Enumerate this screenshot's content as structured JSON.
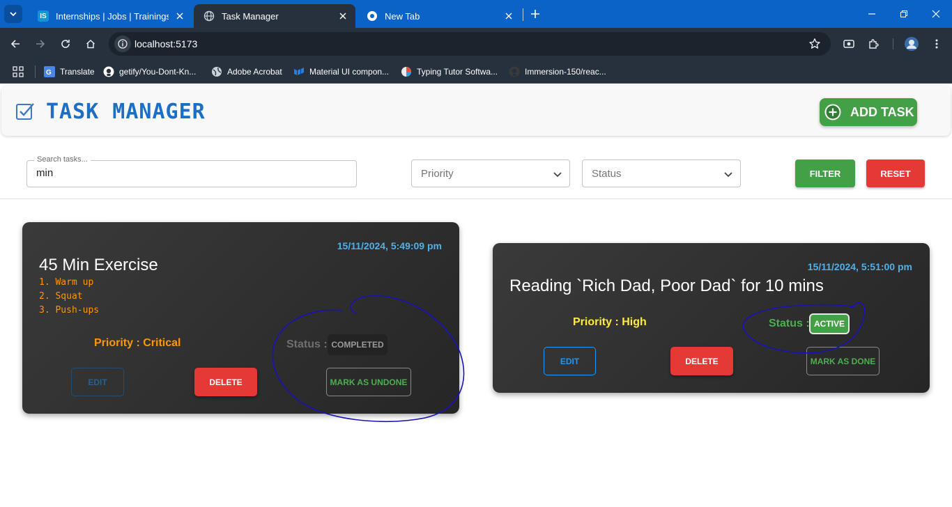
{
  "browser": {
    "tabs": [
      {
        "title": "Internships | Jobs | Trainings & I"
      },
      {
        "title": "Task Manager"
      },
      {
        "title": "New Tab"
      }
    ],
    "url": "localhost:5173",
    "bookmarks": [
      {
        "label": "Translate"
      },
      {
        "label": "getify/You-Dont-Kn..."
      },
      {
        "label": "Adobe Acrobat"
      },
      {
        "label": "Material UI compon..."
      },
      {
        "label": "Typing Tutor Softwa..."
      },
      {
        "label": "Immersion-150/reac..."
      }
    ]
  },
  "app": {
    "title": "TASK MANAGER",
    "add_task_label": "ADD TASK"
  },
  "filters": {
    "search_label": "Search tasks...",
    "search_value": "min",
    "priority_placeholder": "Priority",
    "status_placeholder": "Status",
    "filter_label": "FILTER",
    "reset_label": "RESET"
  },
  "tasks": [
    {
      "date": "15/11/2024, 5:49:09 pm",
      "title": "45 Min Exercise",
      "steps": [
        "1. Warm up",
        "2. Squat",
        "3. Push-ups"
      ],
      "priority": "Priority : Critical",
      "status_label": "Status :",
      "status_value": "COMPLETED",
      "edit_label": "EDIT",
      "delete_label": "DELETE",
      "toggle_label": "MARK AS UNDONE"
    },
    {
      "date": "15/11/2024, 5:51:00 pm",
      "title": "Reading `Rich Dad, Poor Dad` for 10 mins",
      "priority": "Priority : High",
      "status_label": "Status :",
      "status_value": "ACTIVE",
      "edit_label": "EDIT",
      "delete_label": "DELETE",
      "toggle_label": "MARK AS DONE"
    }
  ],
  "colors": {
    "accent_blue": "#1c6fc4",
    "success_green": "#43a047",
    "danger_red": "#e53935",
    "priority_critical": "#ff9800",
    "priority_high": "#ffeb3b",
    "date_blue": "#4fb0ea",
    "annotation_ink": "#1a12b8"
  },
  "icons": {
    "logo": "checkbox-icon",
    "add": "plus-circle-icon",
    "select": "chevron-down-icon"
  }
}
